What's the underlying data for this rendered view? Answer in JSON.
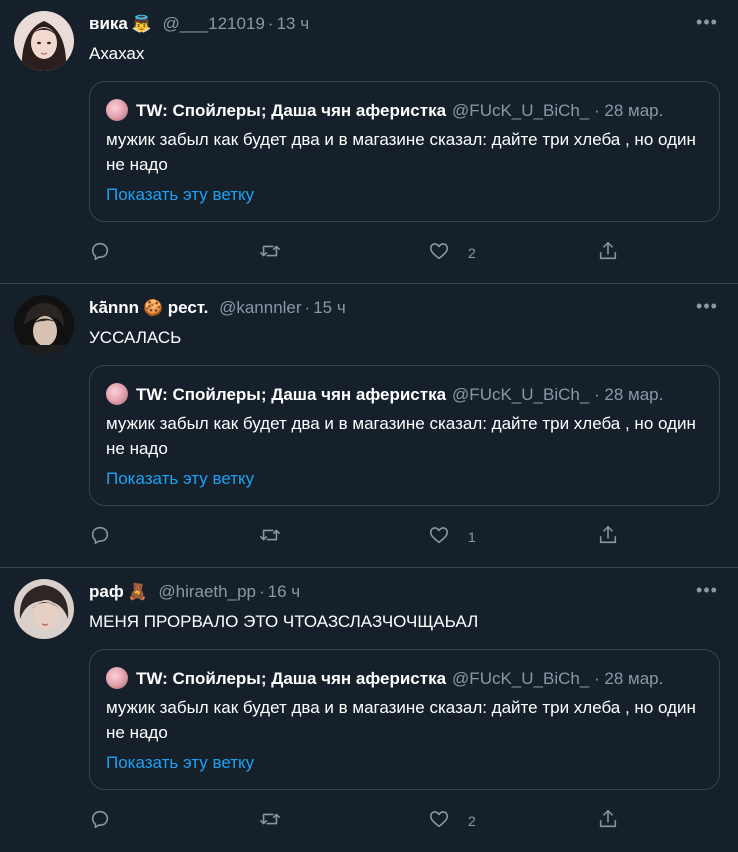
{
  "tweets": [
    {
      "name": "вика",
      "emoji": "👼",
      "handle": "@___121019",
      "time": "13 ч",
      "text": "Ахахах",
      "likes": "2",
      "quote": {
        "name": "TW: Спойлеры; Даша чян аферистка",
        "handle": "@FUcK_U_BiCh_ · 28 мар.",
        "text": "мужик забыл как будет два и в магазине сказал: дайте три хлеба , но один не надо",
        "link": "Показать эту ветку"
      }
    },
    {
      "name": "kā̃nnn",
      "emoji": "🍪",
      "name_suffix": "рест.",
      "handle": "@kannnler",
      "time": "15 ч",
      "text": "УССАЛАСЬ",
      "likes": "1",
      "quote": {
        "name": "TW: Спойлеры; Даша чян аферистка",
        "handle": "@FUcK_U_BiCh_ · 28 мар.",
        "text": "мужик забыл как будет два и в магазине сказал: дайте три хлеба , но один не надо",
        "link": "Показать эту ветку"
      }
    },
    {
      "name": "раф",
      "emoji": "🧸",
      "handle": "@hiraeth_pp",
      "time": "16 ч",
      "text": "МЕНЯ ПРОРВАЛО ЭТО ЧТОАЗСЛАЗЧОЧЩАЬАЛ",
      "likes": "2",
      "quote": {
        "name": "TW: Спойлеры; Даша чян аферистка",
        "handle": "@FUcK_U_BiCh_ · 28 мар.",
        "text": "мужик забыл как будет два и в магазине сказал: дайте три хлеба , но один не надо",
        "link": "Показать эту ветку"
      }
    }
  ],
  "colors": {
    "background": "#15202b",
    "border": "#38444d",
    "secondary_text": "#8899a6",
    "link": "#1da1f2"
  },
  "icons": [
    "more-icon",
    "reply-icon",
    "retweet-icon",
    "like-icon",
    "share-icon"
  ]
}
